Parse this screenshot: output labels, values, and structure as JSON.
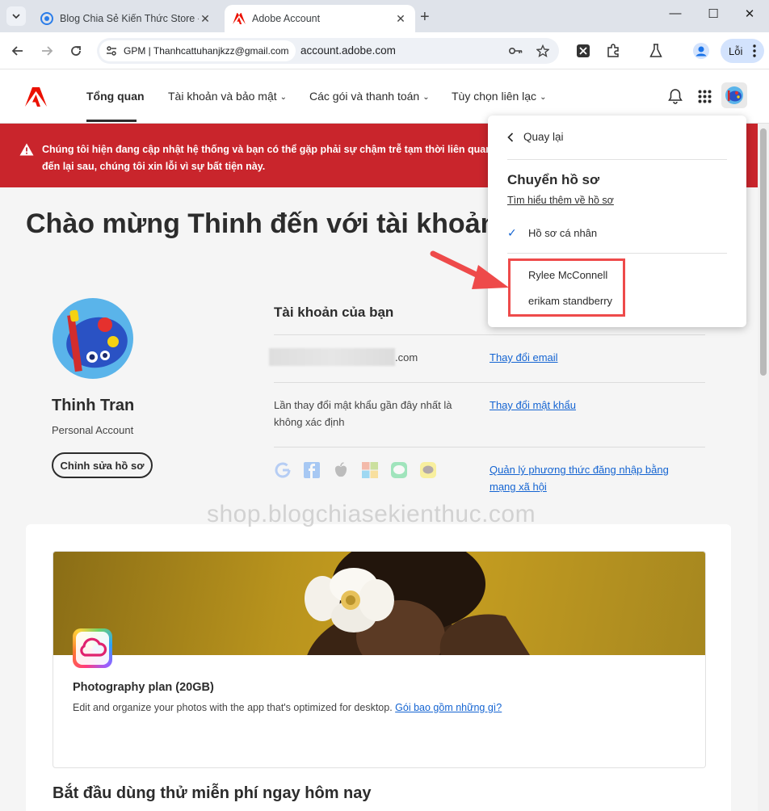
{
  "browser": {
    "tabs": [
      {
        "title": "Blog Chia Sẻ Kiến Thức Store - ",
        "close": "✕"
      },
      {
        "title": "Adobe Account",
        "close": "✕"
      }
    ],
    "new_tab": "+",
    "window_controls": {
      "minimize": "—",
      "maximize": "☐",
      "close": "✕"
    },
    "site_chip": "GPM | Thanhcattuhanjkzz@gmail.com",
    "url": "account.adobe.com",
    "profile_button": "Lỗi"
  },
  "header": {
    "nav": [
      {
        "label": "Tổng quan"
      },
      {
        "label": "Tài khoản và bảo mật"
      },
      {
        "label": "Các gói và thanh toán"
      },
      {
        "label": "Tùy chọn liên lạc"
      }
    ],
    "chevron": "⌄"
  },
  "alert": {
    "text": "Chúng tôi hiện đang cập nhật hệ thống và bạn có thể gặp phải sự chậm trễ tạm thời liên quan đến lại sau, chúng tôi xin lỗi vì sự bất tiện này."
  },
  "main": {
    "welcome": "Chào mừng Thinh đến với tài khoản củ",
    "profile": {
      "name": "Thinh Tran",
      "type": "Personal Account",
      "edit_label": "Chỉnh sửa hồ sơ"
    },
    "account": {
      "title": "Tài khoản của bạn",
      "email_suffix": ".com",
      "change_email": "Thay đổi email",
      "password_text": "Lần thay đổi mật khẩu gần đây nhất là không xác định",
      "change_password": "Thay đổi mật khẩu",
      "social_link": "Quản lý phương thức đăng nhập bằng mạng xã hội"
    },
    "watermark": "shop.blogchiasekienthuc.com",
    "plan": {
      "name": "Photography plan (20GB)",
      "desc": "Edit and organize your photos with the app that's optimized for desktop. ",
      "link": "Gói bao gồm những gì?"
    },
    "free_trial": "Bắt đầu dùng thử miễn phí ngay hôm nay"
  },
  "dropdown": {
    "back": "Quay lại",
    "title": "Chuyển hồ sơ",
    "learn_more": "Tìm hiểu thêm về hồ sơ",
    "personal": "Hồ sơ cá nhân",
    "profiles": [
      "Rylee McConnell",
      "erikam standberry"
    ]
  },
  "colors": {
    "adobe_red": "#eb1000",
    "alert_bg": "#c9252c",
    "link": "#1464d2",
    "highlight": "#ee4a4a"
  }
}
